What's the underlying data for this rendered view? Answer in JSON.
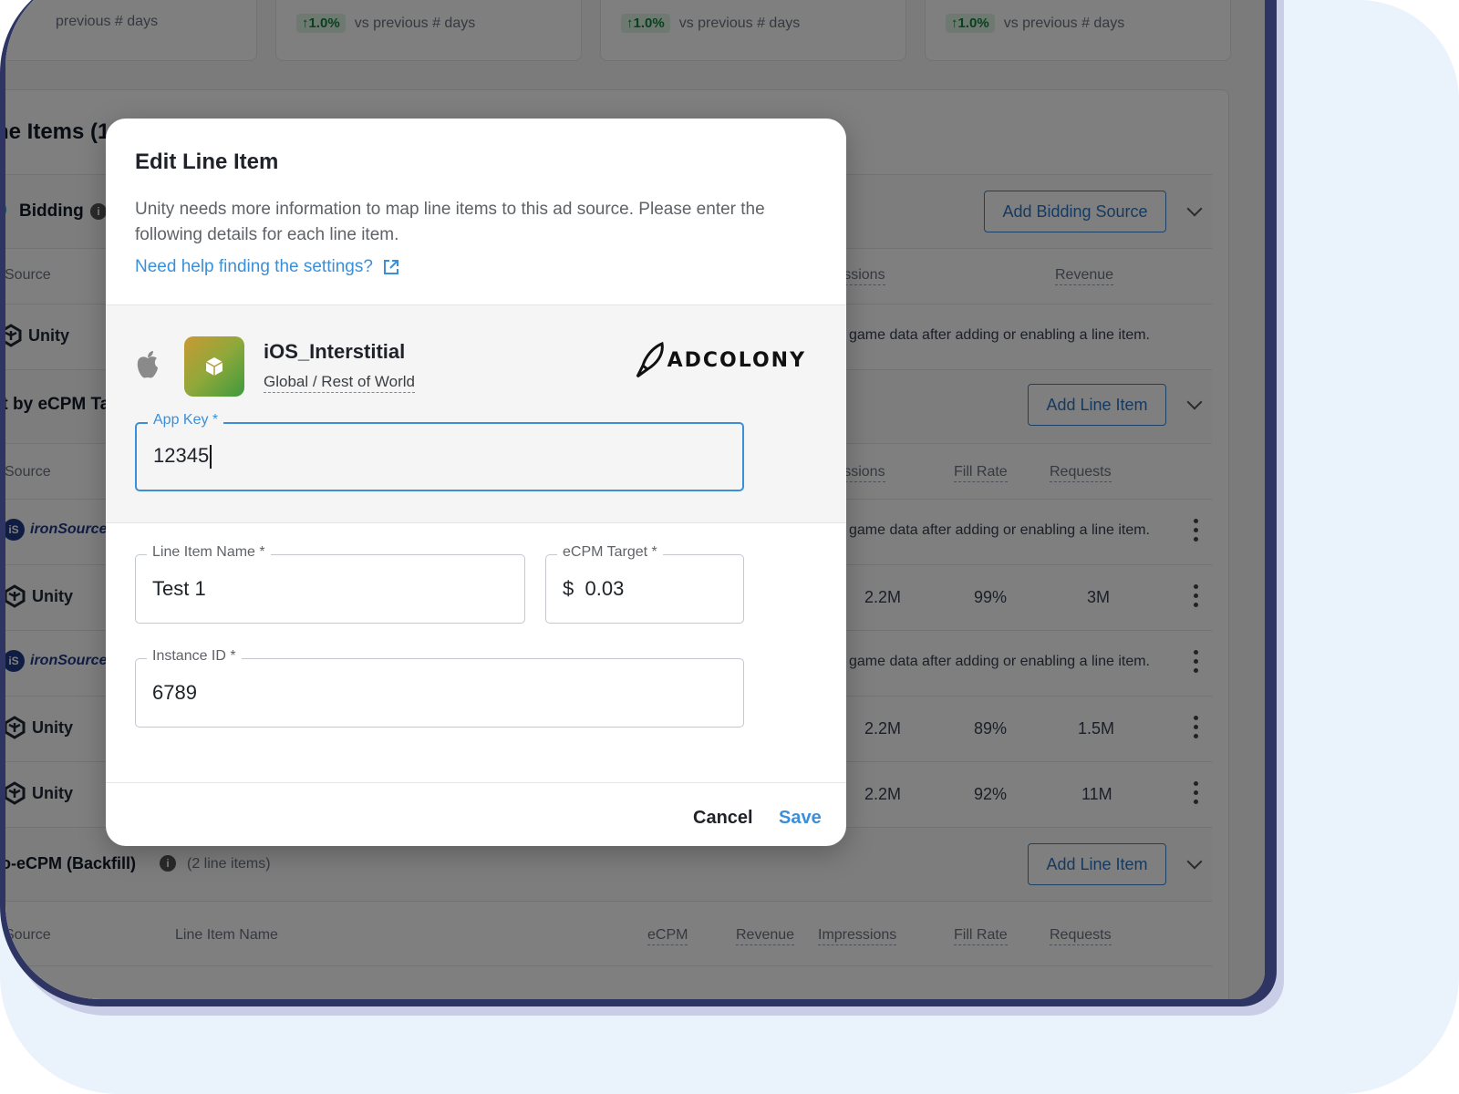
{
  "background": {
    "stats": [
      {
        "pct": "1.0%",
        "suffix": "vs previous # days"
      },
      {
        "pct": "1.0%",
        "suffix": "vs previous # days"
      },
      {
        "pct": "1.0%",
        "suffix": "vs previous # days"
      },
      {
        "pct": "1.0%",
        "suffix": "vs previous # days"
      }
    ],
    "first_stat_partial": "previous # days",
    "panel_title": "ne Items (1",
    "bidding": {
      "label": "Bidding",
      "add_button": "Add Bidding Source",
      "headers": {
        "source": "Source",
        "impressions": "ressions",
        "revenue": "Revenue"
      },
      "row_brand": "Unity",
      "row_message": "game data after adding or enabling a line item."
    },
    "ecpm": {
      "label": "rt by eCPM Ta",
      "add_button": "Add Line Item",
      "headers": {
        "source": "Source",
        "impressions": "ressions",
        "fill_rate": "Fill Rate",
        "requests": "Requests"
      },
      "rows": [
        {
          "brand": "ironSource",
          "message": "game data after adding or enabling a line item."
        },
        {
          "brand": "Unity",
          "impressions": "2.2M",
          "fill_rate": "99%",
          "requests": "3M"
        },
        {
          "brand": "ironSource",
          "message": "game data after adding or enabling a line item."
        },
        {
          "brand": "Unity",
          "impressions": "2.2M",
          "fill_rate": "89%",
          "requests": "1.5M"
        },
        {
          "brand": "Unity",
          "impressions": "2.2M",
          "fill_rate": "92%",
          "requests": "11M"
        }
      ]
    },
    "backfill": {
      "label": "to-eCPM (Backfill)",
      "count": "(2 line items)",
      "add_button": "Add Line Item",
      "headers": {
        "source": "Source",
        "line_item_name": "Line Item Name",
        "ecpm": "eCPM",
        "revenue": "Revenue",
        "impressions": "Impressions",
        "fill_rate": "Fill Rate",
        "requests": "Requests"
      }
    }
  },
  "modal": {
    "title": "Edit Line Item",
    "description": "Unity needs more information to map line items to this ad source. Please enter the following details for each line item.",
    "help_link": "Need help finding the settings?",
    "app": {
      "name": "iOS_Interstitial",
      "region": "Global / Rest of World",
      "network_logo": "ADCOLONY"
    },
    "fields": {
      "app_key": {
        "label": "App Key *",
        "value": "12345"
      },
      "line_item_name": {
        "label": "Line Item Name *",
        "value": "Test 1"
      },
      "ecpm_target": {
        "label": "eCPM Target *",
        "currency": "$",
        "value": "0.03"
      },
      "instance_id": {
        "label": "Instance ID *",
        "value": "6789"
      }
    },
    "cancel_label": "Cancel",
    "save_label": "Save"
  },
  "colors": {
    "accent": "#3b8fd9",
    "device_frame": "#2f3563",
    "backdrop": "#eaf2fc"
  }
}
